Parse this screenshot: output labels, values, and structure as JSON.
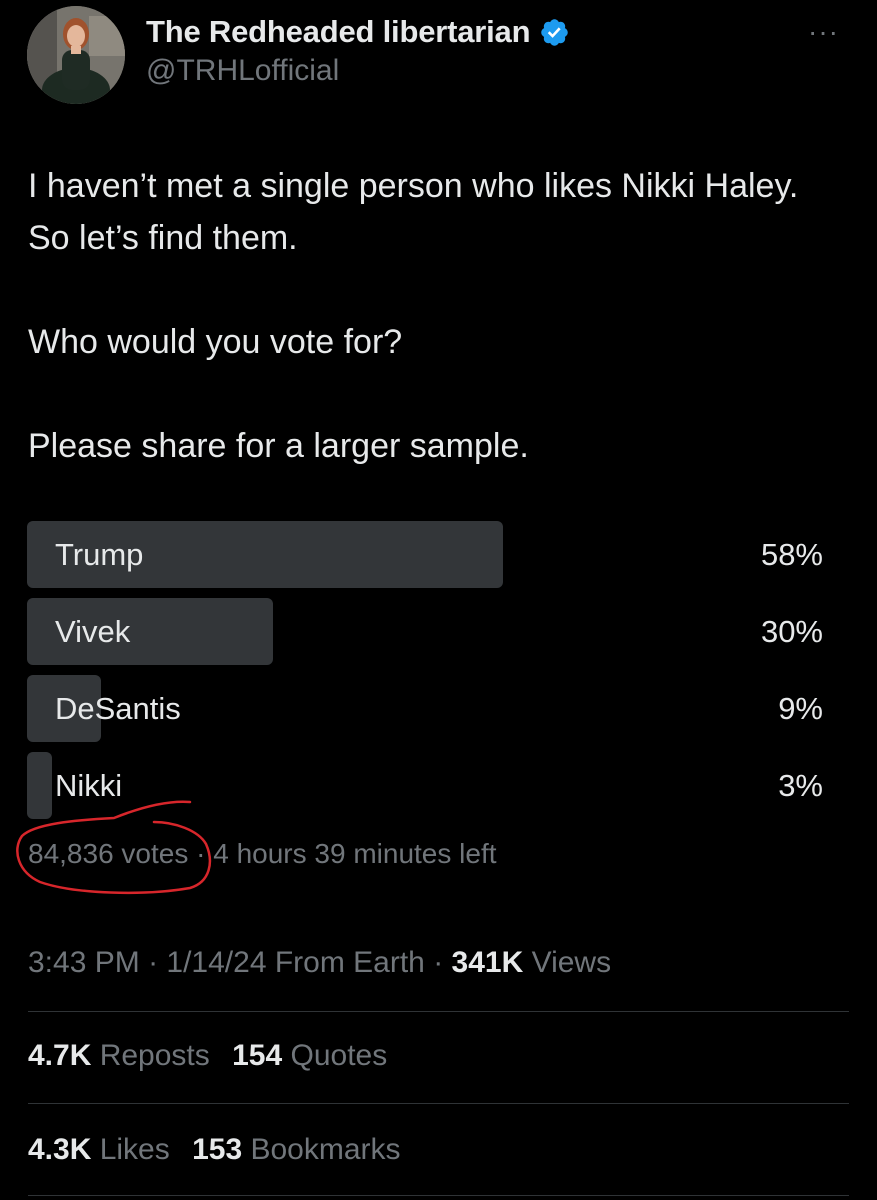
{
  "author": {
    "display_name": "The Redheaded libertarian",
    "handle": "@TRHLofficial",
    "verified_badge_icon": "verified-badge-icon",
    "verified_color": "#1d9bf0"
  },
  "more_icon": "···",
  "tweet": {
    "line1": "I haven’t met a single person who likes Nikki Haley. So let’s find them.",
    "line2": "Who would you vote for?",
    "line3": "Please share for a larger sample."
  },
  "poll": {
    "options": [
      {
        "label": "Trump",
        "percent_text": "58%",
        "percent": 58
      },
      {
        "label": "Vivek",
        "percent_text": "30%",
        "percent": 30
      },
      {
        "label": "DeSantis",
        "percent_text": "9%",
        "percent": 9
      },
      {
        "label": "Nikki",
        "percent_text": "3%",
        "percent": 3
      }
    ],
    "votes": "84,836 votes",
    "separator": " · ",
    "time_left": "4 hours 39 minutes left",
    "annotation_color": "#d7262b"
  },
  "meta": {
    "time": "3:43 PM",
    "sep1": " · ",
    "date": "1/14/24",
    "source": " From Earth",
    "sep2": " · ",
    "views_count": "341K",
    "views_label": " Views"
  },
  "stats": {
    "reposts_count": "4.7K",
    "reposts_label": " Reposts",
    "quotes_count": "154",
    "quotes_label": " Quotes",
    "likes_count": "4.3K",
    "likes_label": " Likes",
    "bookmarks_count": "153",
    "bookmarks_label": " Bookmarks"
  }
}
